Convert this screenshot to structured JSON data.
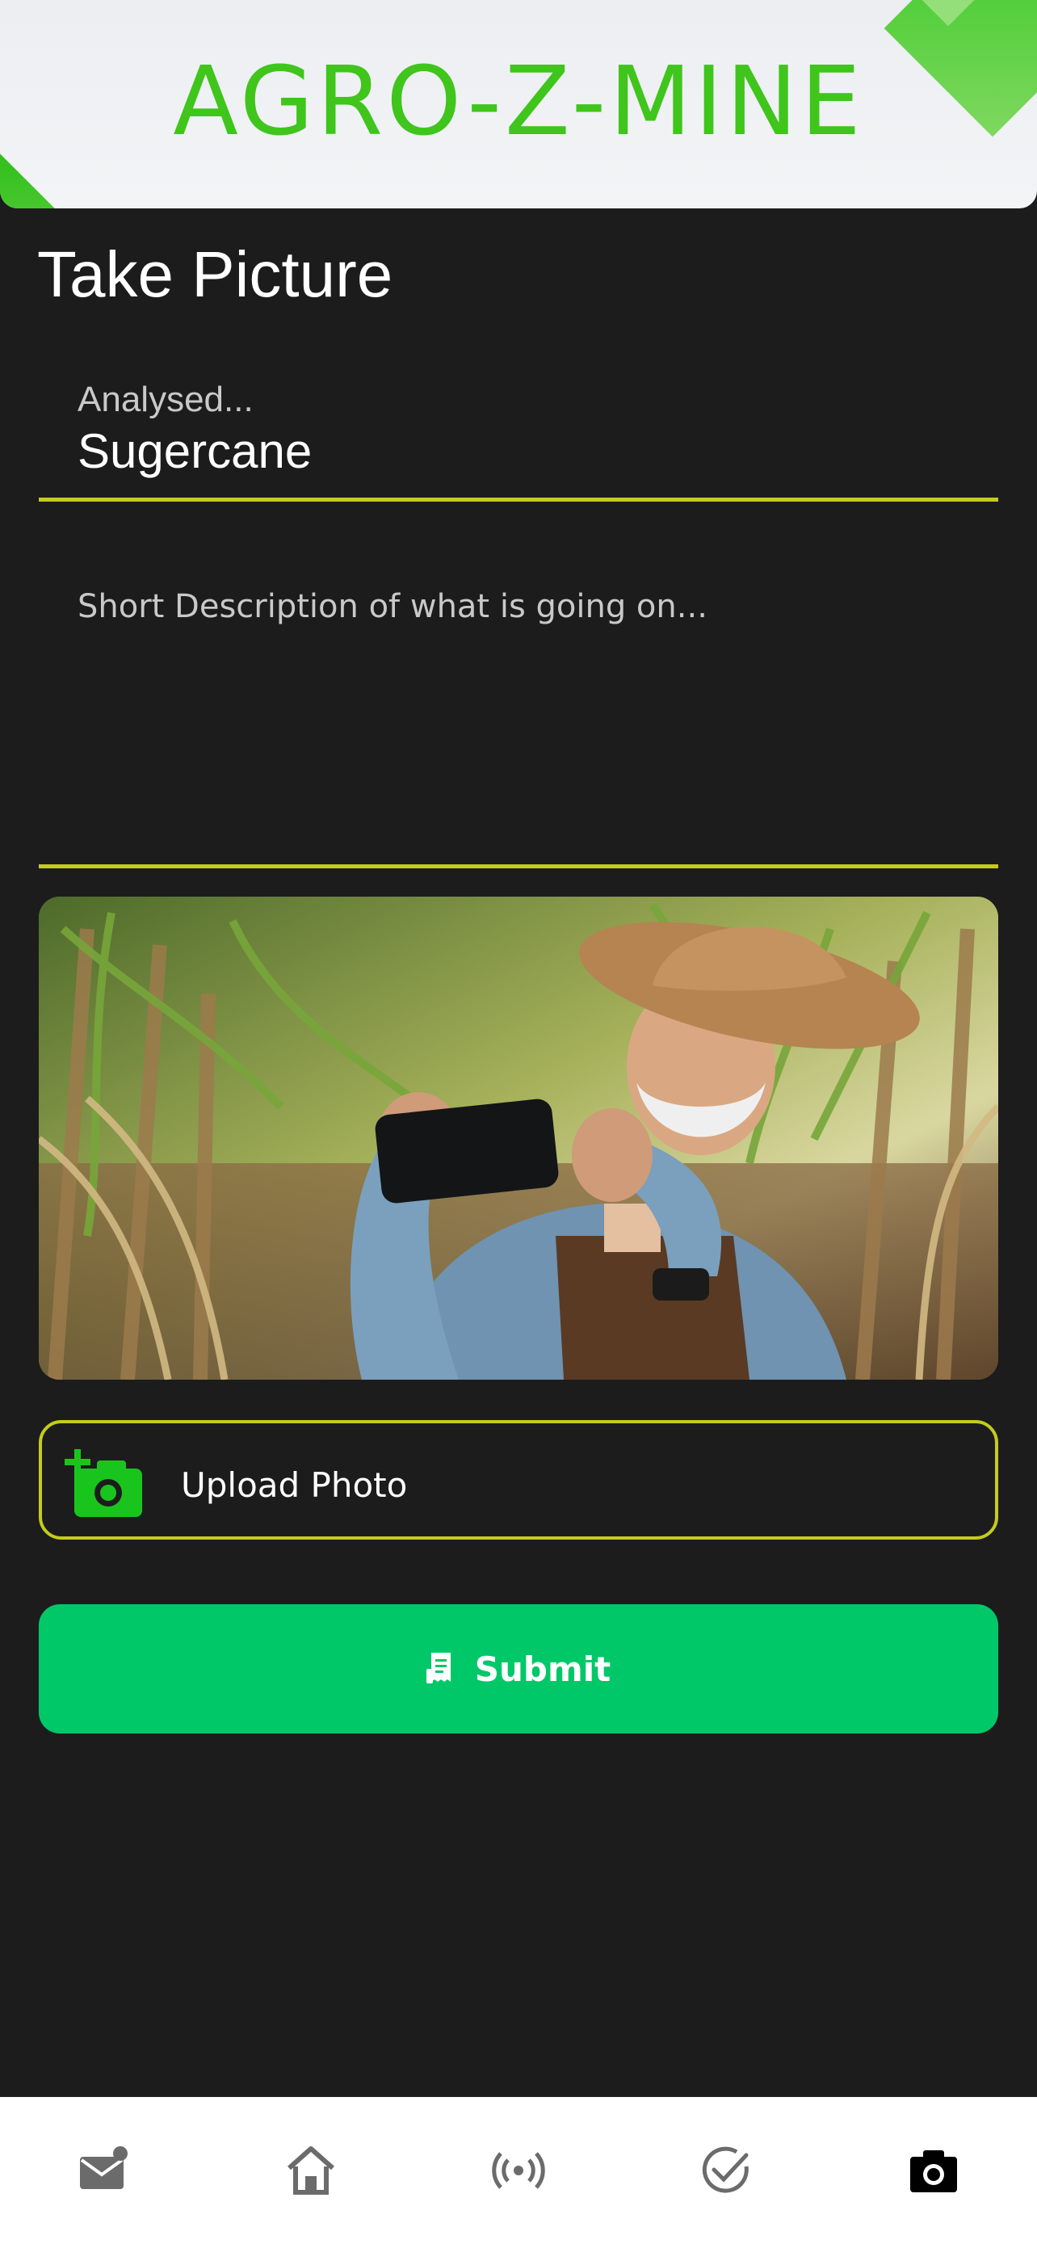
{
  "app": {
    "brand": "AGRO-Z-MINE",
    "brand_color": "#3fc51b"
  },
  "page": {
    "title": "Take Picture"
  },
  "analysed_field": {
    "label": "Analysed...",
    "value": "Sugercane"
  },
  "description_field": {
    "placeholder": "Short Description of what is going on..."
  },
  "photo": {
    "alt": "Farmer in sugarcane field holding a smartphone"
  },
  "upload": {
    "label": "Upload Photo",
    "icon": "add-photo-icon"
  },
  "submit": {
    "label": "Submit",
    "icon": "receipt-icon",
    "color": "#00c869"
  },
  "accent_color": "#c4cc1c",
  "tabbar": {
    "items": [
      {
        "name": "messages",
        "icon": "mail-notification-icon",
        "active": false
      },
      {
        "name": "home",
        "icon": "home-icon",
        "active": false
      },
      {
        "name": "sensors",
        "icon": "broadcast-icon",
        "active": false
      },
      {
        "name": "tasks",
        "icon": "check-circle-icon",
        "active": false
      },
      {
        "name": "camera",
        "icon": "camera-icon",
        "active": true
      }
    ]
  }
}
